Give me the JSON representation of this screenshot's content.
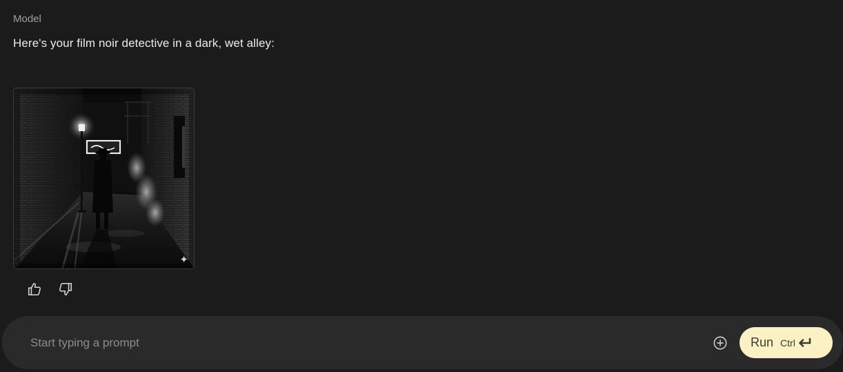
{
  "message": {
    "role": "Model",
    "text": "Here's your film noir detective in a dark, wet alley:",
    "image": {
      "description_icon": "generated-image",
      "badge_icon": "sparkle-icon",
      "badge_glyph": "✦"
    }
  },
  "feedback": {
    "like_icon": "thumbs-up-icon",
    "dislike_icon": "thumbs-down-icon"
  },
  "prompt": {
    "placeholder": "Start typing a prompt",
    "value": "",
    "add_icon": "plus-circle-icon",
    "run_label": "Run",
    "shortcut_label": "Ctrl",
    "enter_icon": "enter-icon"
  },
  "colors": {
    "background": "#1b1b1b",
    "prompt_bar": "#2a2a2a",
    "run_button": "#fbf1c4"
  }
}
